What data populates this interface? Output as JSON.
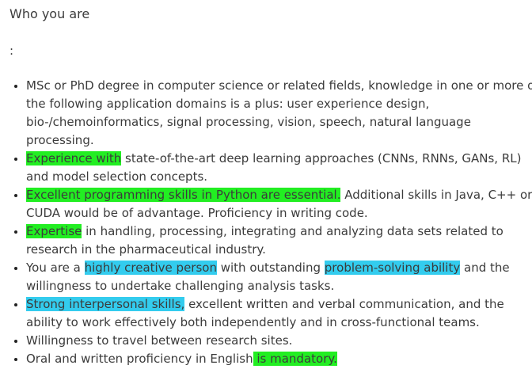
{
  "section": {
    "heading": "Who you are",
    "colon": ":"
  },
  "colors": {
    "highlight_green": "#22ee22",
    "highlight_cyan": "#33ccee",
    "text": "#3b3b3b"
  },
  "items": [
    {
      "text": "MSc or PhD degree in computer science or related fields, knowledge in one or more of the following application domains is a plus: user experience design, bio-/chemoinformatics, signal processing, vision, speech, natural language processing."
    },
    {
      "hl": "Experience with",
      "rest": " state-of-the-art deep learning approaches (CNNs, RNNs, GANs, RL) and model selection concepts."
    },
    {
      "hl": "Excellent programming skills in Python are essential.",
      "rest": " Additional skills in Java, C++ or CUDA would be of advantage. Proficiency in writing code."
    },
    {
      "hl": "Expertise",
      "rest": " in handling, processing, integrating and analyzing data sets related to research in the pharmaceutical industry."
    },
    {
      "pre": "You are a ",
      "hl1": "highly creative person",
      "mid": " with outstanding ",
      "hl2": "problem-solving ability",
      "rest": " and the willingness to undertake challenging analysis tasks."
    },
    {
      "hl": "Strong interpersonal skills,",
      "rest": " excellent written and verbal communication, and the ability to work effectively both independently and in cross-functional teams."
    },
    {
      "text": "Willingness to travel between research sites."
    },
    {
      "pre": "Oral and written proficiency in English",
      "hl": " is mandatory. "
    }
  ]
}
